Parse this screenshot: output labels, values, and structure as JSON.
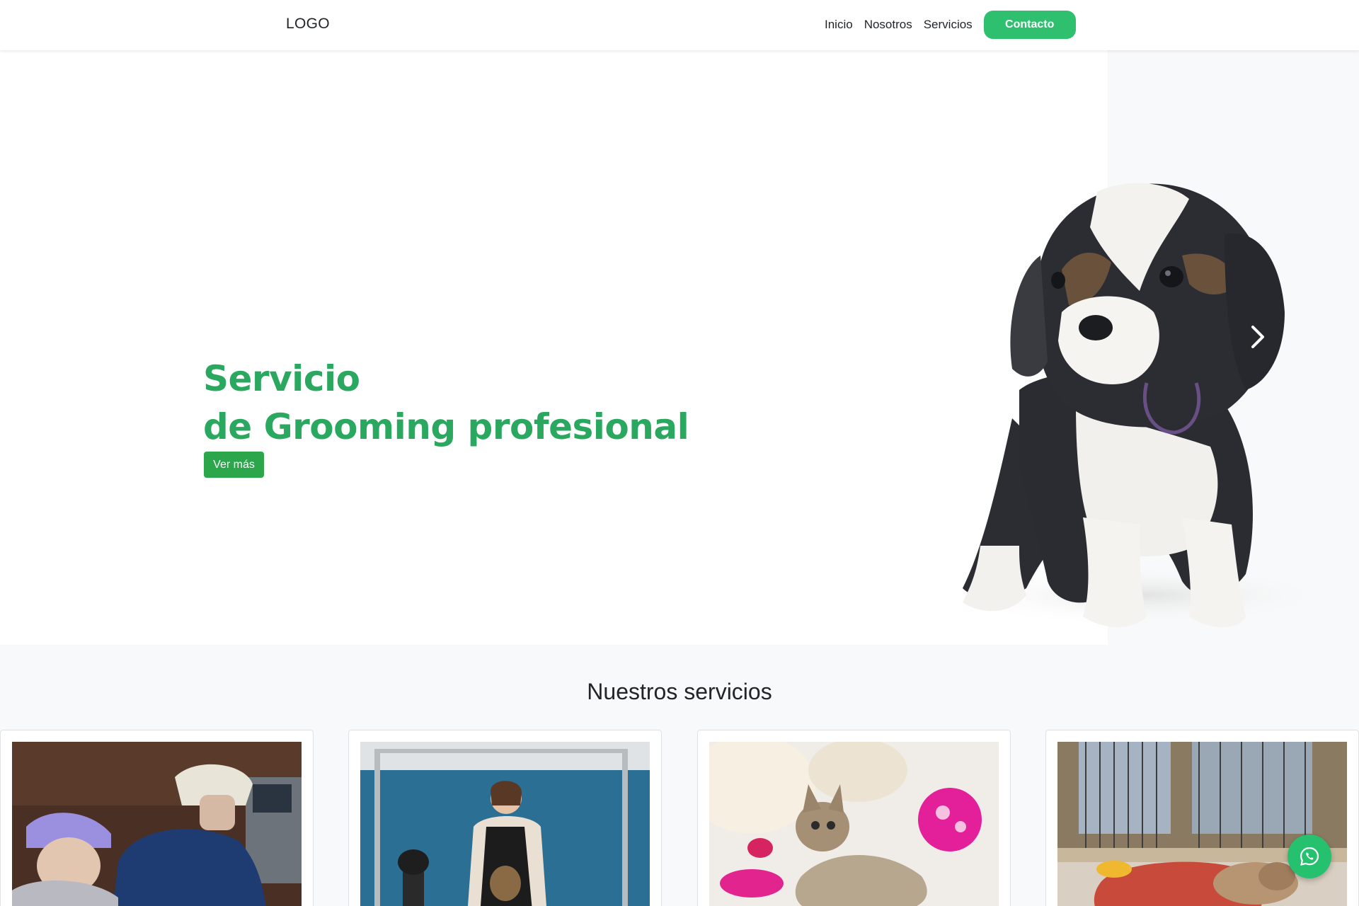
{
  "nav": {
    "logo": "LOGO",
    "links": [
      "Inicio",
      "Nosotros",
      "Servicios"
    ],
    "contact_label": "Contacto"
  },
  "hero": {
    "title_line1": "Servicio",
    "title_line2": "de Grooming profesional",
    "button_label": "Ver más"
  },
  "services": {
    "title": "Nuestros servicios",
    "cards": [
      {
        "image": "veterinary-surgery-photo"
      },
      {
        "image": "groomer-with-yorkshire-photo"
      },
      {
        "image": "kitten-with-toys-photo"
      },
      {
        "image": "puppy-in-kennel-photo"
      }
    ]
  },
  "colors": {
    "brand_green": "#2ec06f",
    "title_green": "#2ba860",
    "button_green": "#2ba64a",
    "whatsapp_green": "#25c16f"
  }
}
